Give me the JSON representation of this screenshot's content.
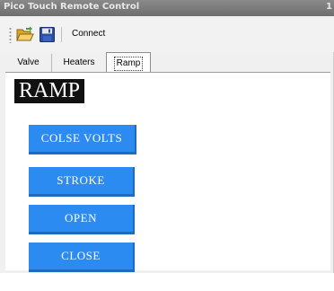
{
  "window": {
    "title": "Pico Touch Remote Control",
    "title_extra": "1"
  },
  "toolbar": {
    "open_icon": "folder-open-icon",
    "save_icon": "floppy-save-icon",
    "connect_label": "Connect"
  },
  "tabs": [
    {
      "label": "Valve",
      "active": false
    },
    {
      "label": "Heaters",
      "active": false
    },
    {
      "label": "Ramp",
      "active": true
    }
  ],
  "panel": {
    "heading": "RAMP",
    "buttons": [
      {
        "label": "COLSE VOLTS"
      },
      {
        "label": "STROKE"
      },
      {
        "label": "OPEN"
      },
      {
        "label": "CLOSE"
      }
    ]
  },
  "colors": {
    "button_bg": "#2b8bf0",
    "heading_bg": "#111111"
  }
}
